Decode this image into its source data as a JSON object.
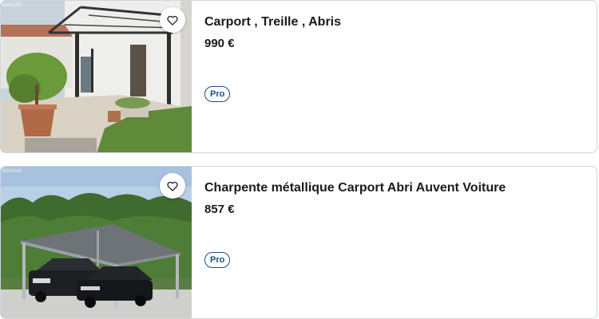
{
  "listings": [
    {
      "title": "Carport , Treille , Abris",
      "price": "990 €",
      "badge": "Pro",
      "favorite_icon": "heart-outline-icon",
      "image_watermark": "boncoin"
    },
    {
      "title": "Charpente métallique Carport Abri Auvent Voiture",
      "price": "857 €",
      "badge": "Pro",
      "favorite_icon": "heart-outline-icon",
      "image_watermark": "boncoin"
    }
  ],
  "colors": {
    "badge_blue": "#1b4f8a",
    "card_border": "#cdd6e2",
    "text": "#1a1a1a"
  }
}
